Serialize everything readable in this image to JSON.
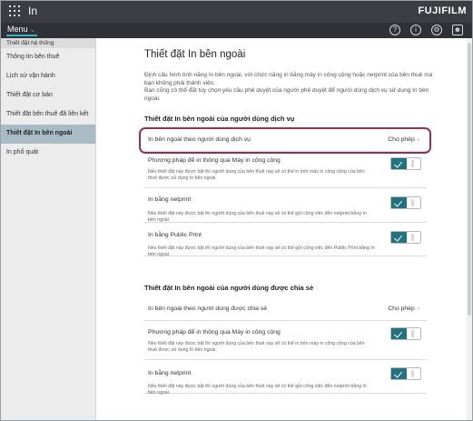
{
  "topbar": {
    "app_title": "In",
    "brand": "FUJIFILM"
  },
  "menubar": {
    "menu_label": "Menu",
    "icons": [
      "help-icon",
      "info-icon",
      "gear-icon",
      "user-icon"
    ]
  },
  "sidebar": {
    "header": "Thiết đặt hệ thống",
    "items": [
      {
        "label": "Thông tin bên thuê",
        "active": false
      },
      {
        "label": "Lịch sử vận hành",
        "active": false
      },
      {
        "label": "Thiết đặt cơ bản",
        "active": false
      },
      {
        "label": "Thiết đặt bên thuê đã liên kết",
        "active": false
      },
      {
        "label": "Thiết đặt In bên ngoài",
        "active": true
      },
      {
        "label": "In phổ quát",
        "active": false
      }
    ]
  },
  "main": {
    "title": "Thiết đặt In bên ngoài",
    "intro_1": "Định cấu hình tính năng In bên ngoài, với chức năng in bằng máy in công cộng hoặc netprint của bên thuê mà bạn không phải thành viên.",
    "intro_2": "Bạn cũng có thể đặt tùy chọn yêu cầu phê duyệt của người phê duyệt để người dùng dịch vụ sử dụng In bên ngoài.",
    "section1": {
      "title": "Thiết đặt In bên ngoài của người dùng dịch vụ",
      "rows": {
        "r0": {
          "label": "In bên ngoài theo người dùng dịch vụ",
          "value": "Cho phép"
        },
        "r1": {
          "label": "Phương pháp để in thông qua Máy in công cộng",
          "desc": "Nếu thiết đặt này được bật thì người dùng của bên thuê này sẽ có thể in trên máy in công cộng của bên thuê được sử dụng In bên ngoài.",
          "enabled": true
        },
        "r2": {
          "label": "In bằng netprint",
          "desc": "Nếu thiết đặt này được bật thì người dùng của bên thuê này sẽ có thể gửi công việc đến netprint bằng In bên ngoài.",
          "enabled": true
        },
        "r3": {
          "label": "In bằng Public Print",
          "desc": "Nếu thiết đặt này được bật thì người dùng của bên thuê này sẽ có thể gửi công việc đến Public Print bằng In bên ngoài.",
          "enabled": true
        }
      }
    },
    "section2": {
      "title": "Thiết đặt In bên ngoài của người dùng được chia sẻ",
      "rows": {
        "r0": {
          "label": "In bên ngoài theo người dùng được chia sẻ",
          "value": "Cho phép"
        },
        "r1": {
          "label": "Phương pháp để in thông qua Máy in công cộng",
          "desc": "Nếu thiết đặt này được bật thì người dùng của bên thuê này sẽ có thể in trên máy in công cộng của bên thuê được sử dụng In bên ngoài.",
          "enabled": true
        },
        "r2": {
          "label": "In bằng netprint",
          "desc": "Nếu thiết đặt này được bật thì người dùng của bên thuê này sẽ có thể gửi công việc đến netprint bằng In bên ngoài.",
          "enabled": true
        }
      }
    }
  },
  "colors": {
    "topbar": "#3b3d42",
    "accent": "#227381",
    "highlight": "#9a2d57",
    "sidebar_active": "#a9bcc6"
  }
}
